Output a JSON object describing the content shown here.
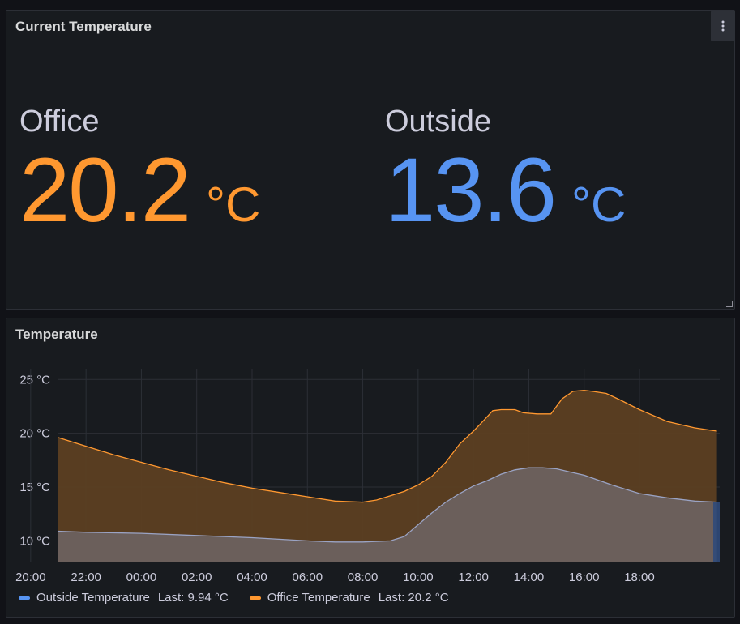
{
  "colors": {
    "office": "#ff9830",
    "outside": "#5794f2",
    "office_fill": "#5c3f22",
    "outside_fill": "#6b5f5b",
    "grid": "#2c2f36"
  },
  "stat_panel": {
    "title": "Current Temperature",
    "menu_icon": "kebab-menu-icon",
    "stats": [
      {
        "name": "Office",
        "value": "20.2",
        "unit": "°C"
      },
      {
        "name": "Outside",
        "value": "13.6",
        "unit": "°C"
      }
    ]
  },
  "timeseries_panel": {
    "title": "Temperature",
    "legend": [
      {
        "label": "Outside Temperature",
        "last_label": "Last: 9.94 °C"
      },
      {
        "label": "Office Temperature",
        "last_label": "Last: 20.2 °C"
      }
    ]
  },
  "chart_data": {
    "type": "area",
    "xlabel": "",
    "ylabel": "",
    "x_ticks": [
      "22:00",
      "00:00",
      "02:00",
      "04:00",
      "06:00",
      "08:00",
      "10:00",
      "12:00",
      "14:00",
      "16:00",
      "18:00",
      "20:00"
    ],
    "y_ticks": [
      "10 °C",
      "15 °C",
      "20 °C",
      "25 °C"
    ],
    "ylim": [
      8,
      26
    ],
    "xlim_hours": [
      21.0,
      44.9
    ],
    "grid": true,
    "legend_position": "bottom-left",
    "series": [
      {
        "name": "Office Temperature",
        "x_hours": [
          21.0,
          22.0,
          23.0,
          24.0,
          25.0,
          26.0,
          27.0,
          28.0,
          29.0,
          30.0,
          31.0,
          32.0,
          32.5,
          33.0,
          33.5,
          34.0,
          34.5,
          35.0,
          35.5,
          36.0,
          36.3,
          36.7,
          37.0,
          37.5,
          37.8,
          38.3,
          38.8,
          39.2,
          39.6,
          40.0,
          40.3,
          40.8,
          41.3,
          42.0,
          43.0,
          44.0,
          44.8
        ],
        "values": [
          19.6,
          18.8,
          18.0,
          17.3,
          16.6,
          16.0,
          15.4,
          14.9,
          14.5,
          14.1,
          13.7,
          13.6,
          13.8,
          14.2,
          14.6,
          15.2,
          16.0,
          17.3,
          19.0,
          20.2,
          21.0,
          22.1,
          22.2,
          22.2,
          21.9,
          21.8,
          21.8,
          23.2,
          23.9,
          24.0,
          23.9,
          23.7,
          23.1,
          22.2,
          21.1,
          20.5,
          20.2
        ]
      },
      {
        "name": "Outside Temperature",
        "x_hours": [
          21.0,
          22.0,
          24.0,
          26.0,
          28.0,
          30.0,
          31.0,
          32.0,
          33.0,
          33.5,
          34.0,
          34.5,
          35.0,
          35.5,
          36.0,
          36.5,
          37.0,
          37.5,
          38.0,
          38.5,
          39.0,
          39.5,
          40.0,
          41.0,
          42.0,
          43.0,
          44.0,
          44.8
        ],
        "values": [
          10.9,
          10.8,
          10.7,
          10.5,
          10.3,
          10.0,
          9.9,
          9.9,
          10.0,
          10.4,
          11.5,
          12.6,
          13.6,
          14.4,
          15.1,
          15.6,
          16.2,
          16.6,
          16.8,
          16.8,
          16.7,
          16.4,
          16.1,
          15.2,
          14.4,
          14.0,
          13.7,
          13.6
        ]
      }
    ]
  }
}
